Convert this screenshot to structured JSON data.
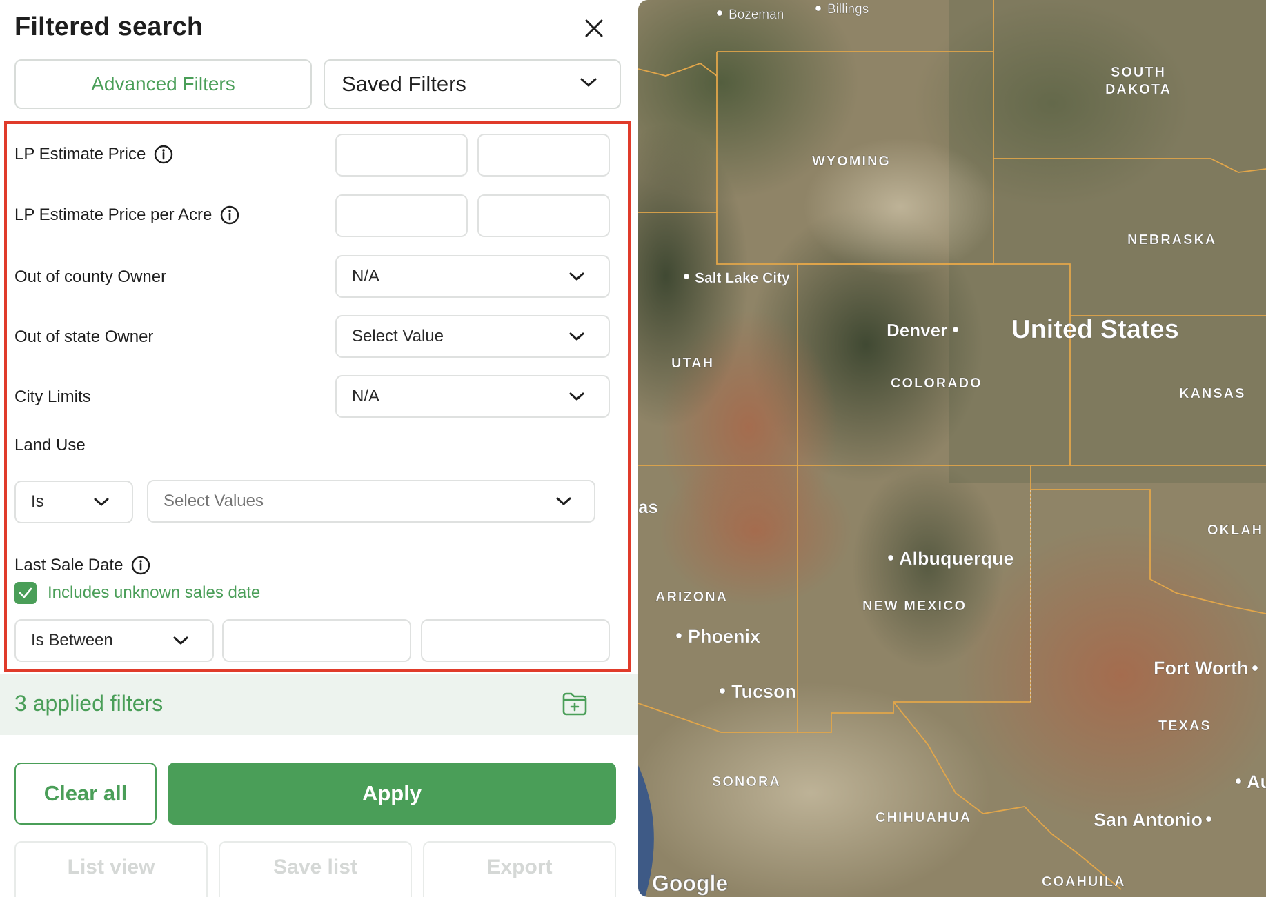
{
  "panel": {
    "title": "Filtered search",
    "tabs": {
      "advanced": "Advanced Filters",
      "saved": "Saved Filters"
    },
    "filters": {
      "lp_estimate_price": {
        "label": "LP Estimate Price"
      },
      "lp_estimate_price_per_acre": {
        "label": "LP Estimate Price per Acre"
      },
      "out_of_county_owner": {
        "label": "Out of county Owner",
        "value": "N/A"
      },
      "out_of_state_owner": {
        "label": "Out of state Owner",
        "value": "Select Value"
      },
      "city_limits": {
        "label": "City Limits",
        "value": "N/A"
      },
      "land_use": {
        "label": "Land Use",
        "operator": "Is",
        "placeholder": "Select Values"
      },
      "last_sale_date": {
        "label": "Last Sale Date",
        "checkbox_label": "Includes unknown sales date",
        "checked": true,
        "operator": "Is Between"
      }
    },
    "applied": "3 applied filters",
    "buttons": {
      "clear": "Clear all",
      "apply": "Apply",
      "list_view": "List view",
      "save_list": "Save list",
      "export": "Export"
    }
  },
  "map": {
    "places": {
      "bozeman": "Bozeman",
      "billings": "Billings",
      "south_dakota": "SOUTH\nDAKOTA",
      "wyoming": "WYOMING",
      "nebraska": "NEBRASKA",
      "salt_lake_city": "Salt Lake City",
      "denver": "Denver",
      "united_states": "United States",
      "utah": "UTAH",
      "colorado": "COLORADO",
      "kansas": "KANSAS",
      "las": "as",
      "oklah": "OKLAH",
      "albuquerque": "Albuquerque",
      "arizona": "ARIZONA",
      "new_mexico": "NEW MEXICO",
      "phoenix": "Phoenix",
      "fort_worth": "Fort Worth",
      "tucson": "Tucson",
      "texas": "TEXAS",
      "sonora": "SONORA",
      "au": "Au",
      "chihuahua": "CHIHUAHUA",
      "san_antonio": "San Antonio",
      "coahuila": "COAHUILA"
    },
    "logo": "Google"
  },
  "colors": {
    "accent": "#4a9e58",
    "highlight": "#e03b2a",
    "border_lines": "#e2a64a"
  }
}
